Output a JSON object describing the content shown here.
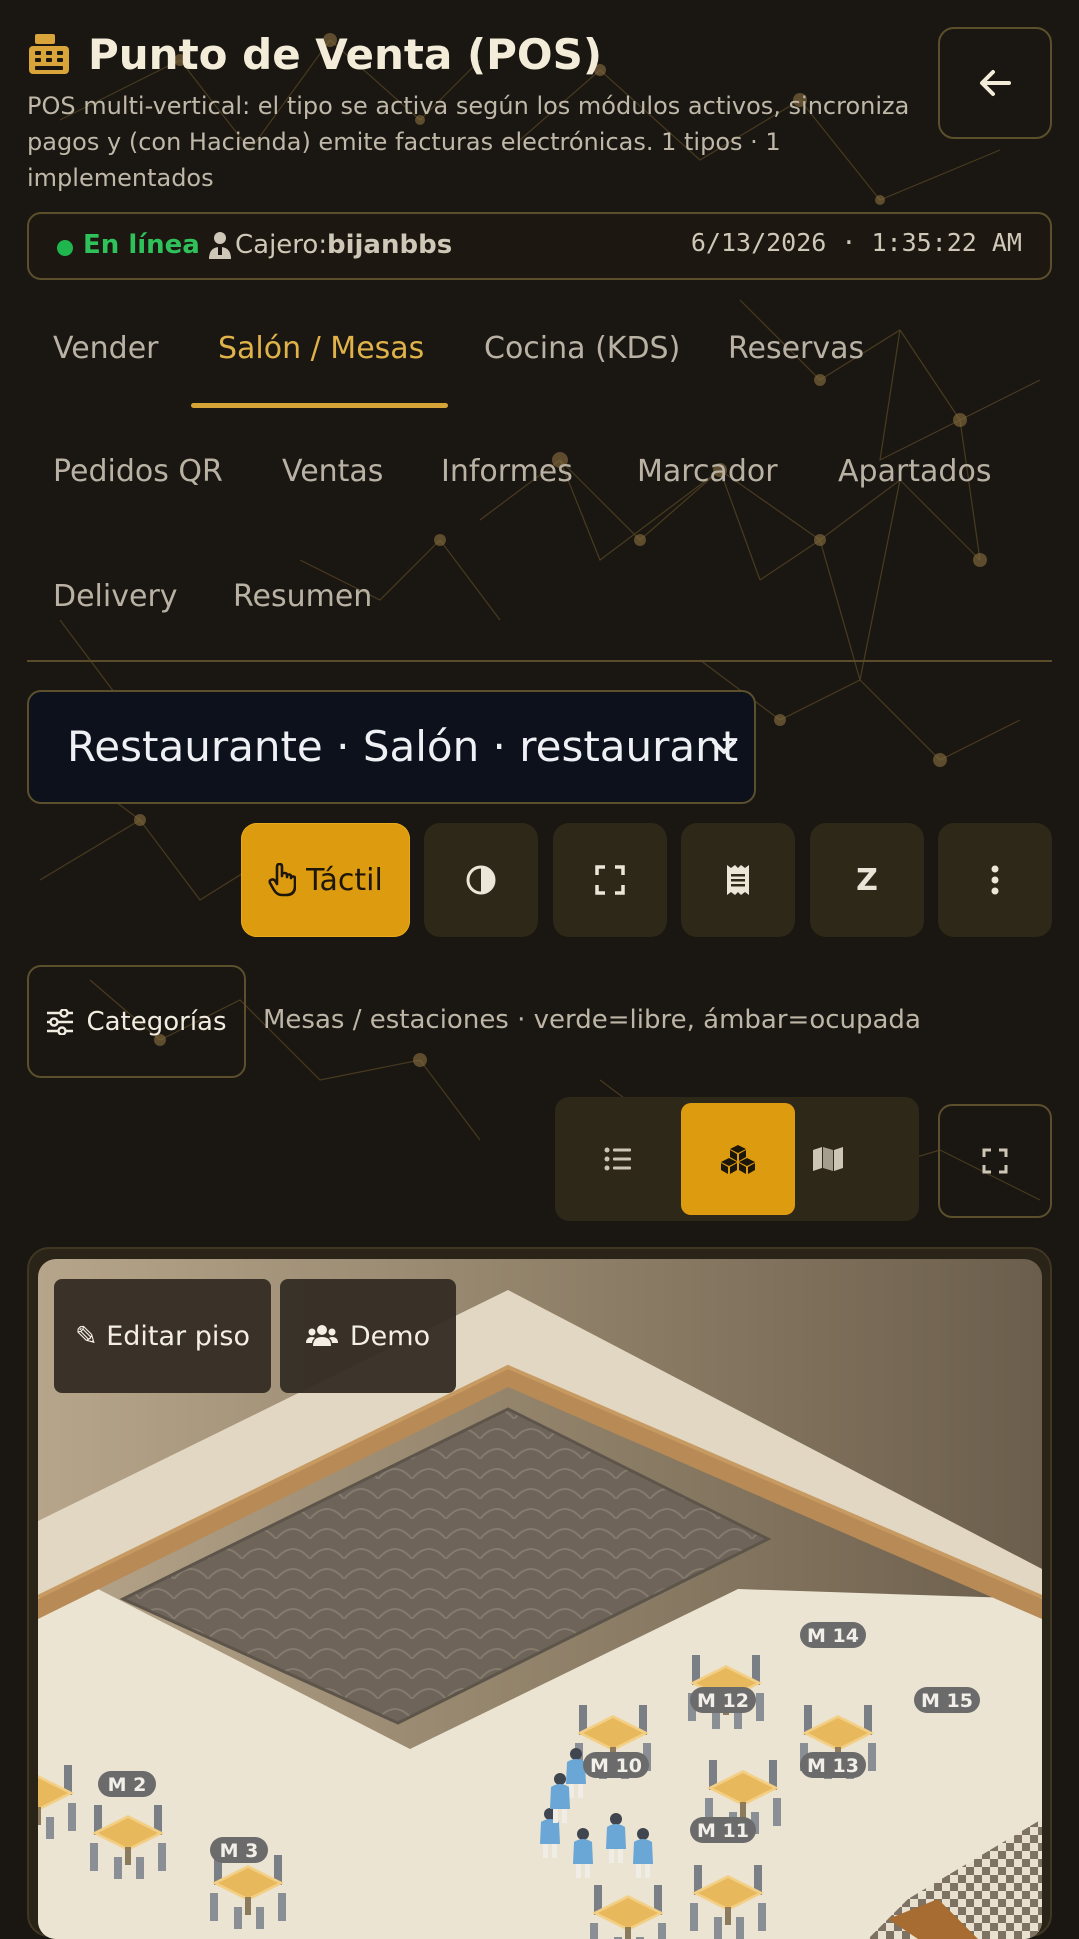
{
  "header": {
    "title": "Punto de Venta (POS)",
    "subtitle": "POS multi-vertical: el tipo se activa según los módulos activos, sincroniza pagos y (con Hacienda) emite facturas electrónicas. 1 tipos · 1 implementados",
    "title_icon": "cash-register-icon",
    "back_icon": "arrow-left-icon"
  },
  "status": {
    "online": "En línea",
    "cashier_label": "Cajero:",
    "cashier_name": "bijanbbs",
    "datetime": "6/13/2026 · 1:35:22 AM"
  },
  "tabs": {
    "vender": "Vender",
    "salon": "Salón / Mesas",
    "cocina": "Cocina (KDS)",
    "reservas": "Reservas",
    "pedidos_qr": "Pedidos QR",
    "ventas": "Ventas",
    "informes": "Informes",
    "marcador": "Marcador",
    "apartados": "Apartados",
    "delivery": "Delivery",
    "resumen": "Resumen",
    "active": "Salón / Mesas"
  },
  "location": {
    "selected": "Restaurante · Salón · restaurant"
  },
  "toolbar": {
    "touch_label": "Táctil",
    "z_label": "Z",
    "icons": [
      "hand-pointer-icon",
      "contrast-icon",
      "expand-icon",
      "receipt-icon",
      "more-vertical-icon"
    ]
  },
  "floor": {
    "categories_label": "Categorías",
    "legend": "Mesas / estaciones · verde=libre, ámbar=ocupada",
    "view_modes": [
      "list-icon",
      "cubes-icon",
      "map-icon"
    ],
    "active_view": "cubes-icon",
    "edit_floor_label": "✎ Editar piso",
    "demo_label": "Demo",
    "tables": [
      "M 2",
      "M 3",
      "M 10",
      "M 11",
      "M 12",
      "M 13",
      "M 14",
      "M 15"
    ]
  },
  "colors": {
    "accent": "#dd9b0f",
    "active_tab": "#e0b24a",
    "online": "#2fc25a",
    "background": "#1a1612"
  }
}
